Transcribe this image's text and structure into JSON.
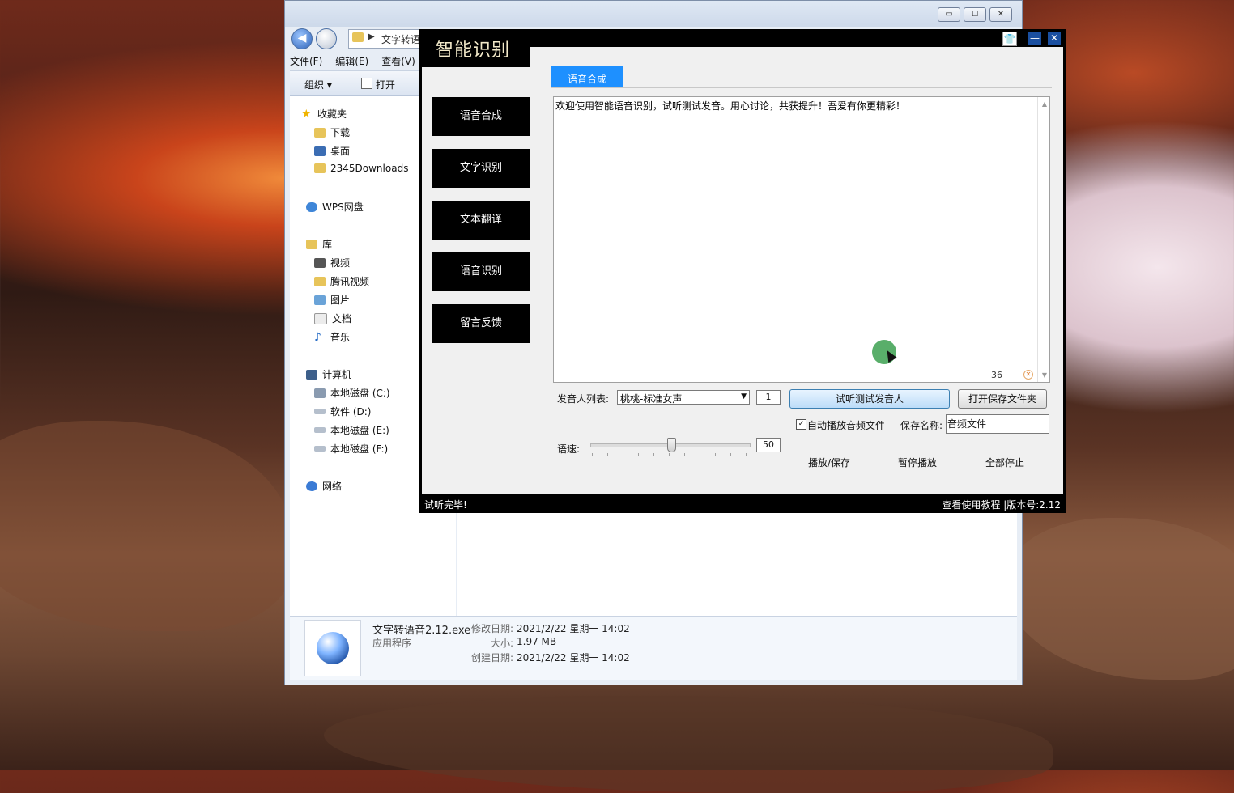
{
  "explorer": {
    "address": "文字转语",
    "menu": [
      "文件(F)",
      "编辑(E)",
      "查看(V)"
    ],
    "toolbar": {
      "organize": "组织 ▾",
      "open": "打开"
    },
    "tree": [
      {
        "label": "收藏夹"
      },
      {
        "label": "下载"
      },
      {
        "label": "桌面"
      },
      {
        "label": "2345Downloads"
      },
      {
        "label": "WPS网盘"
      },
      {
        "label": "库"
      },
      {
        "label": "视频"
      },
      {
        "label": "腾讯视频"
      },
      {
        "label": "图片"
      },
      {
        "label": "文档"
      },
      {
        "label": "音乐"
      },
      {
        "label": "计算机"
      },
      {
        "label": "本地磁盘 (C:)"
      },
      {
        "label": "软件 (D:)"
      },
      {
        "label": "本地磁盘 (E:)"
      },
      {
        "label": "本地磁盘 (F:)"
      },
      {
        "label": "网络"
      }
    ],
    "details": {
      "filename": "文字转语音2.12.exe",
      "type": "应用程序",
      "modified_label": "修改日期:",
      "modified_value": "2021/2/22 星期一 14:02",
      "size_label": "大小:",
      "size_value": "1.97 MB",
      "created_label": "创建日期:",
      "created_value": "2021/2/22 星期一 14:02"
    },
    "window_buttons": {
      "minimize": "▭",
      "maximize": "⧠",
      "close": "✕"
    }
  },
  "app": {
    "title": "智能识别",
    "controls": {
      "skin": "👕",
      "minimize": "—",
      "close": "✕"
    },
    "sidebar": [
      "语音合成",
      "文字识别",
      "文本翻译",
      "语音识别",
      "留言反馈"
    ],
    "active_tab": "语音合成",
    "text_content": "欢迎使用智能语音识别，试听测试发音。用心讨论，共获提升！吾爱有你更精彩！",
    "char_count": "36",
    "speaker_label": "发音人列表:",
    "speaker_value": "桃桃-标准女声",
    "speaker_count": "1",
    "preview_button": "试听测试发音人",
    "open_folder_button": "打开保存文件夹",
    "autoplay_label": "自动播放音频文件",
    "autoplay_checked": true,
    "save_name_label": "保存名称:",
    "save_name_value": "音频文件",
    "speed_label": "语速:",
    "speed_value": "50",
    "speed_fraction": 0.5,
    "play_save": "播放/保存",
    "pause": "暂停播放",
    "stop_all": "全部停止",
    "status_left": "试听完毕!",
    "status_right": "查看使用教程 |版本号:2.12"
  },
  "colors": {
    "tab_active": "#1e90ff",
    "app_frame": "#000000",
    "app_title": "#f2e9c9"
  }
}
